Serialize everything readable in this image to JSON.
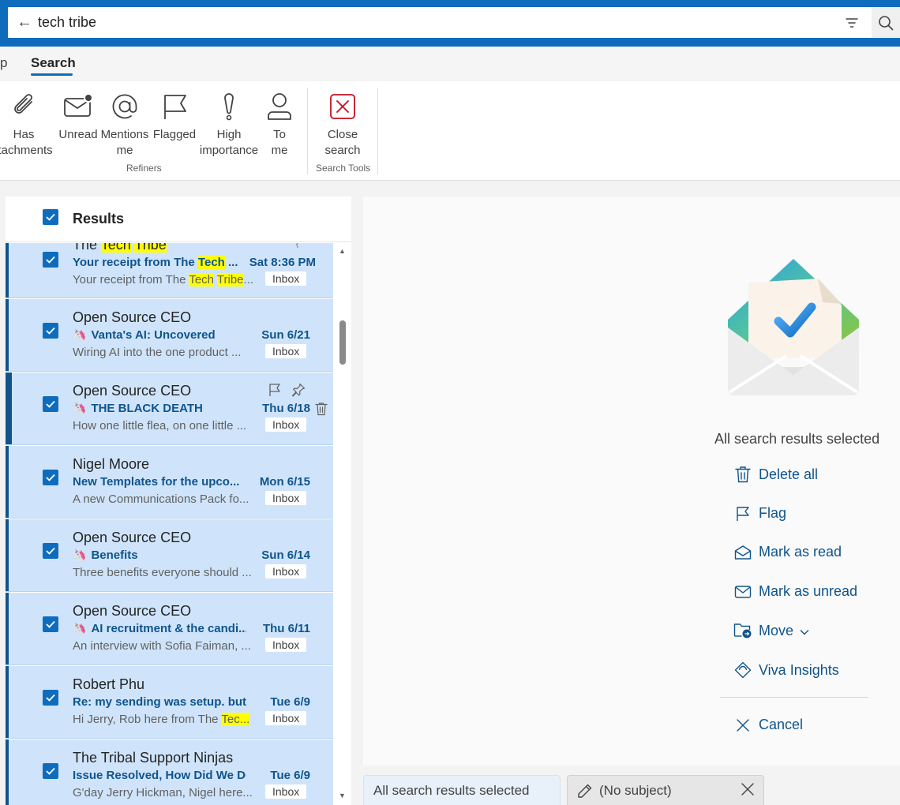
{
  "search": {
    "query": "tech tribe"
  },
  "tabs": {
    "partial": "p",
    "search": "Search"
  },
  "ribbon": {
    "refiners": [
      {
        "line1": "Has",
        "line2": "ttachments",
        "icon": "paperclip-icon"
      },
      {
        "line1": "Unread",
        "line2": "",
        "icon": "unread-mail-icon"
      },
      {
        "line1": "Mentions",
        "line2": "me",
        "icon": "at-sign-icon"
      },
      {
        "line1": "Flagged",
        "line2": "",
        "icon": "flag-icon"
      },
      {
        "line1": "High",
        "line2": "importance",
        "icon": "exclamation-icon"
      },
      {
        "line1": "To",
        "line2": "me",
        "icon": "person-icon"
      }
    ],
    "refiners_label": "Refiners",
    "close_line1": "Close",
    "close_line2": "search",
    "tools_label": "Search Tools"
  },
  "list": {
    "header": "Results",
    "rows": [
      {
        "sender_pre": "The ",
        "sender_hl1": "Tech",
        "sender_mid": " ",
        "sender_hl2": "Tribe",
        "subject_pre": "Your receipt from The ",
        "subject_hl": "Tech",
        "subject_post": " ...",
        "date": "Sat 8:36 PM",
        "preview_pre": "Your receipt from The ",
        "preview_hl1": "Tech",
        "preview_mid": " ",
        "preview_hl2": "Tribe",
        "preview_post": "...",
        "folder": "Inbox"
      },
      {
        "sender": "Open Source CEO",
        "subject": "Vanta's AI: Uncovered",
        "date": "Sun 6/21",
        "preview": "Wiring AI into the one product ...",
        "folder": "Inbox"
      },
      {
        "sender": "Open Source CEO",
        "subject": "THE BLACK DEATH",
        "date": "Thu 6/18",
        "preview": "How one little flea, on one little ...",
        "folder": "Inbox"
      },
      {
        "sender": "Nigel Moore",
        "subject": "New Templates for the upco...",
        "date": "Mon 6/15",
        "preview": "A new Communications Pack fo...",
        "folder": "Inbox"
      },
      {
        "sender": "Open Source CEO",
        "subject": "Benefits",
        "date": "Sun 6/14",
        "preview": "Three benefits everyone should ...",
        "folder": "Inbox"
      },
      {
        "sender": "Open Source CEO",
        "subject": "AI recruitment & the candi...",
        "date": "Thu 6/11",
        "preview": "An interview with Sofia Faiman, ...",
        "folder": "Inbox"
      },
      {
        "sender": "Robert Phu",
        "subject": "Re: my sending was setup. but ...",
        "date": "Tue 6/9",
        "preview_pre": "Hi Jerry, Rob here from The ",
        "preview_hl": "Tec...",
        "folder": "Inbox"
      },
      {
        "sender": "The Tribal Support Ninjas",
        "subject": "Issue Resolved, How Did We Do...",
        "date": "Tue 6/9",
        "preview": "G'day Jerry Hickman, Nigel here...",
        "folder": "Inbox"
      }
    ]
  },
  "reading": {
    "title": "All search results selected",
    "actions": [
      {
        "label": "Delete all",
        "icon": "trash-icon"
      },
      {
        "label": "Flag",
        "icon": "flag-icon"
      },
      {
        "label": "Mark as read",
        "icon": "open-envelope-icon"
      },
      {
        "label": "Mark as unread",
        "icon": "envelope-icon"
      },
      {
        "label": "Move",
        "icon": "folder-move-icon"
      },
      {
        "label": "Viva Insights",
        "icon": "viva-insights-icon"
      }
    ],
    "cancel": "Cancel"
  },
  "bottom_tabs": {
    "tab1": "All search results selected",
    "tab2": "(No subject)"
  },
  "colors": {
    "accent": "#0f6cbd",
    "row_selected": "#cfe4fa",
    "link": "#0f548c",
    "highlight": "#ffff00"
  }
}
